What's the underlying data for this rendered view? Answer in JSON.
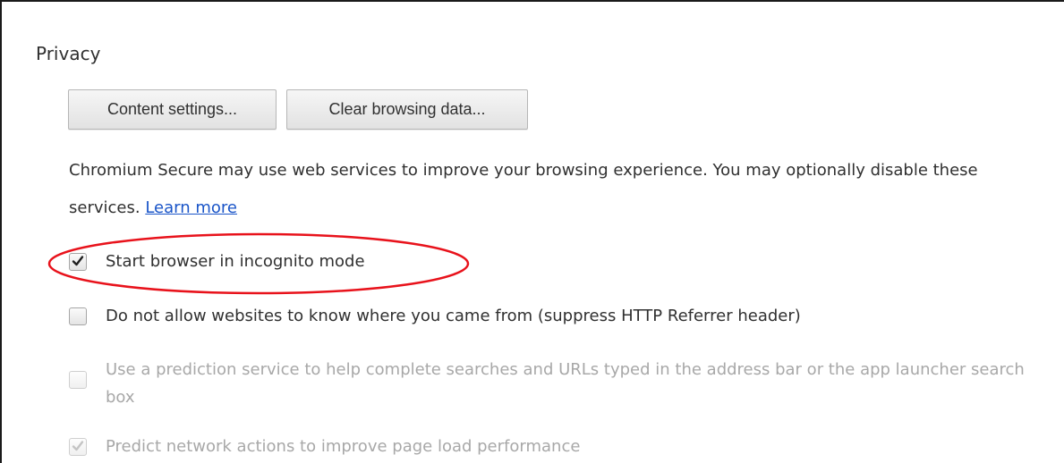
{
  "privacy": {
    "section_title": "Privacy",
    "buttons": {
      "content_settings": "Content settings...",
      "clear_browsing_data": "Clear browsing data..."
    },
    "description": {
      "text": "Chromium Secure may use web services to improve your browsing experience. You may optionally disable these services. ",
      "learn_more_link": "Learn more"
    },
    "options": [
      {
        "label": "Start browser in incognito mode",
        "checked": true,
        "enabled": true
      },
      {
        "label": "Do not allow websites to know where you came from (suppress HTTP Referrer header)",
        "checked": false,
        "enabled": true
      },
      {
        "label": "Use a prediction service to help complete searches and URLs typed in the address bar or the app launcher search box",
        "checked": false,
        "enabled": false
      },
      {
        "label": "Predict network actions to improve page load performance",
        "checked": true,
        "enabled": false
      }
    ]
  },
  "colors": {
    "link": "#1a55c8",
    "annotation_ellipse": "#e8121b",
    "disabled_text": "#a8a8a8"
  }
}
